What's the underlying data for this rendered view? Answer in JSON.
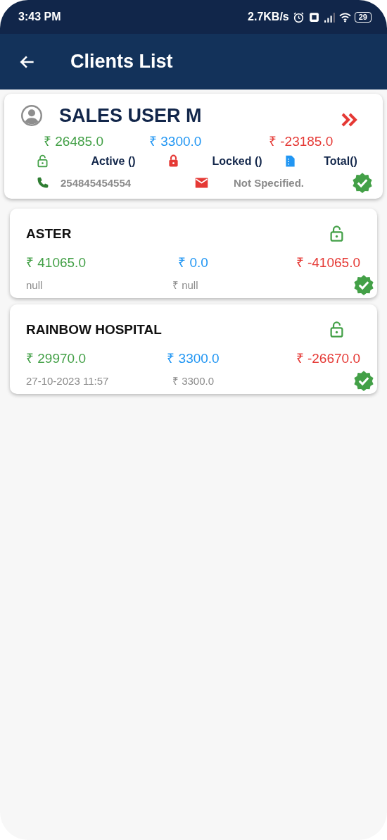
{
  "status_bar": {
    "time": "3:43 PM",
    "speed": "2.7KB/s",
    "battery": "29"
  },
  "app_bar": {
    "title": "Clients List"
  },
  "summary": {
    "name": "SALES USER M",
    "amounts": [
      "₹ 26485.0",
      "₹ 3300.0",
      "₹ -23185.0"
    ],
    "active": "Active ()",
    "locked": "Locked ()",
    "total": "Total()",
    "phone": "254845454554",
    "email": "Not Specified.",
    "verified": true
  },
  "clients": [
    {
      "name": "ASTER",
      "locked": false,
      "verified": true,
      "amounts": [
        "₹ 41065.0",
        "₹ 0.0",
        "₹ -41065.0"
      ],
      "date": "null",
      "last_amount": "₹ null"
    },
    {
      "name": "RAINBOW HOSPITAL",
      "locked": false,
      "verified": true,
      "amounts": [
        "₹ 29970.0",
        "₹ 3300.0",
        "₹ -26670.0"
      ],
      "date": "27-10-2023 11:57",
      "last_amount": "₹ 3300.0"
    }
  ]
}
